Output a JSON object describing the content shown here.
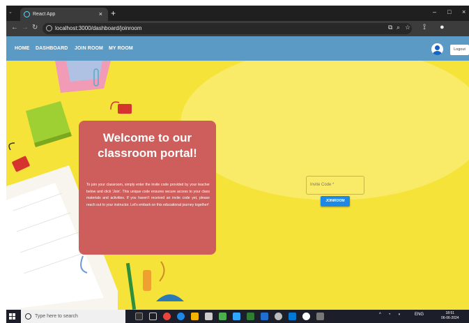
{
  "browser": {
    "tab_title": "React App",
    "tab_close": "×",
    "new_tab": "+",
    "url": "localhost:3000/dashboard/joinroom",
    "window_controls": [
      "–",
      "□",
      "×"
    ]
  },
  "navbar": {
    "links": [
      "HOME",
      "DASHBOARD",
      "JOIN ROOM",
      "MY ROOM"
    ],
    "logout_label": "Logout",
    "bar_color": "#5b9ac4"
  },
  "welcome": {
    "heading": "Welcome to our classroom portal!",
    "body": "To join your classroom, simply enter the invite code provided by your teacher below and click 'Join'. This unique code ensures secure access to your class materials and activities. If you haven't received an invite code yet, please reach out to your instructor. Let's embark on this educational journey together!",
    "card_color": "#cd5e5c"
  },
  "join_form": {
    "placeholder": "Invite Code *",
    "button_label": "JOINROOM",
    "button_color": "#1e88e5"
  },
  "taskbar": {
    "search_placeholder": "Type here to search",
    "tray_lang": "ENG",
    "time": "18:51",
    "date": "06-06-2024"
  },
  "icons": [
    "react-favicon-icon",
    "back-arrow-icon",
    "forward-arrow-icon",
    "reload-icon",
    "site-info-icon",
    "cast-icon",
    "zoom-icon",
    "bookmark-star-icon",
    "extensions-icon",
    "profile-icon",
    "user-avatar-icon",
    "windows-start-icon",
    "search-ring-icon"
  ]
}
